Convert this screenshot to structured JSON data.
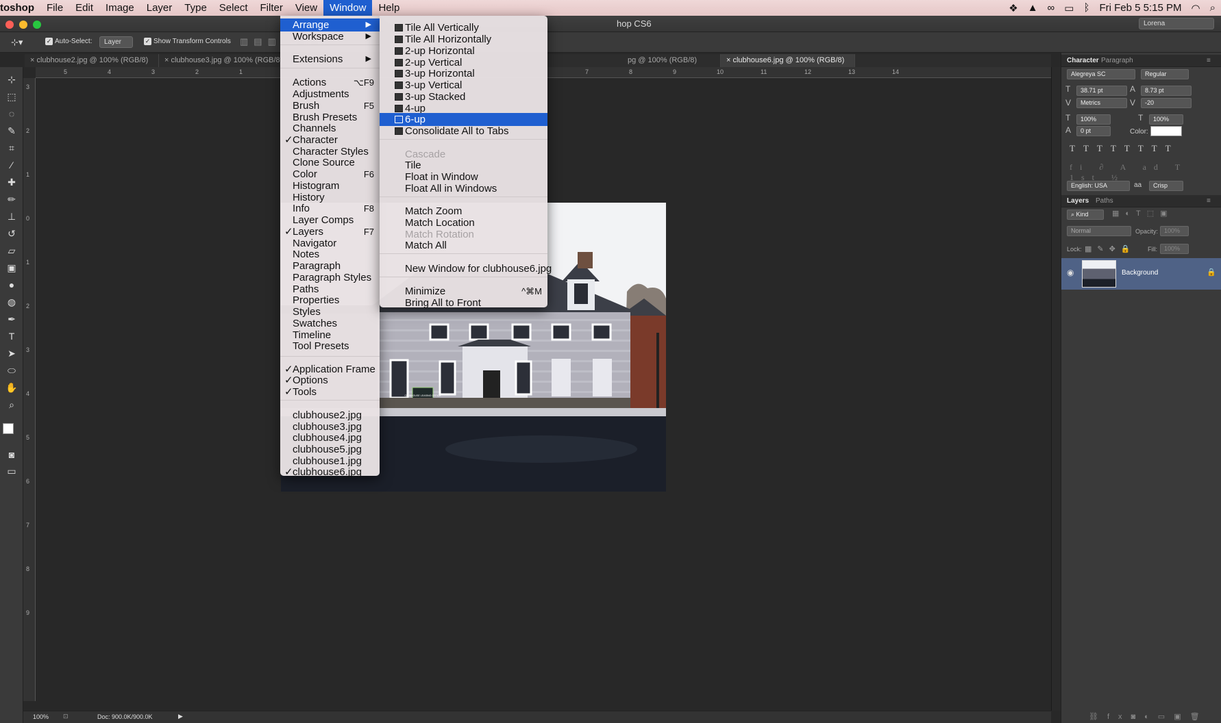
{
  "menubar": {
    "app": "toshop",
    "items": [
      "File",
      "Edit",
      "Image",
      "Layer",
      "Type",
      "Select",
      "Filter",
      "View",
      "Window",
      "Help"
    ],
    "clock": "Fri Feb 5  5:15 PM"
  },
  "titlebar": {
    "title": "hop CS6",
    "workspace": "Lorena"
  },
  "options": {
    "auto_select_label": "Auto-Select:",
    "auto_select_value": "Layer",
    "show_transform": "Show Transform Controls"
  },
  "tabs": [
    "clubhouse2.jpg @ 100% (RGB/8)",
    "clubhouse3.jpg @ 100% (RGB/8)",
    "clu",
    "pg @ 100% (RGB/8)",
    "clubhouse6.jpg @ 100% (RGB/8)"
  ],
  "ruler_h": [
    "5",
    "4",
    "3",
    "2",
    "1",
    "7",
    "8",
    "9",
    "10",
    "11",
    "12",
    "13",
    "14"
  ],
  "ruler_v": [
    "3",
    "2",
    "1",
    "0",
    "1",
    "2",
    "3",
    "4",
    "5",
    "6",
    "7",
    "8",
    "9"
  ],
  "window_menu": {
    "items": [
      {
        "label": "Arrange",
        "arrow": true,
        "highlight": true
      },
      {
        "label": "Workspace",
        "arrow": true
      },
      {
        "label": "Extensions",
        "arrow": true
      },
      {
        "label": "Actions",
        "shortcut": "⌥F9"
      },
      {
        "label": "Adjustments"
      },
      {
        "label": "Brush",
        "shortcut": "F5"
      },
      {
        "label": "Brush Presets"
      },
      {
        "label": "Channels"
      },
      {
        "label": "Character",
        "checked": true
      },
      {
        "label": "Character Styles"
      },
      {
        "label": "Clone Source"
      },
      {
        "label": "Color",
        "shortcut": "F6"
      },
      {
        "label": "Histogram"
      },
      {
        "label": "History"
      },
      {
        "label": "Info",
        "shortcut": "F8"
      },
      {
        "label": "Layer Comps"
      },
      {
        "label": "Layers",
        "checked": true,
        "shortcut": "F7"
      },
      {
        "label": "Navigator"
      },
      {
        "label": "Notes"
      },
      {
        "label": "Paragraph"
      },
      {
        "label": "Paragraph Styles"
      },
      {
        "label": "Paths"
      },
      {
        "label": "Properties"
      },
      {
        "label": "Styles"
      },
      {
        "label": "Swatches"
      },
      {
        "label": "Timeline"
      },
      {
        "label": "Tool Presets"
      },
      {
        "label": "Application Frame",
        "checked": true
      },
      {
        "label": "Options",
        "checked": true
      },
      {
        "label": "Tools",
        "checked": true
      },
      {
        "label": "clubhouse2.jpg"
      },
      {
        "label": "clubhouse3.jpg"
      },
      {
        "label": "clubhouse4.jpg"
      },
      {
        "label": "clubhouse5.jpg"
      },
      {
        "label": "clubhouse1.jpg"
      },
      {
        "label": "clubhouse6.jpg",
        "checked": true
      }
    ]
  },
  "arrange_menu": {
    "items": [
      {
        "label": "Tile All Vertically",
        "icon": true
      },
      {
        "label": "Tile All Horizontally",
        "icon": true
      },
      {
        "label": "2-up Horizontal",
        "icon": true
      },
      {
        "label": "2-up Vertical",
        "icon": true
      },
      {
        "label": "3-up Horizontal",
        "icon": true
      },
      {
        "label": "3-up Vertical",
        "icon": true
      },
      {
        "label": "3-up Stacked",
        "icon": true
      },
      {
        "label": "4-up",
        "icon": true
      },
      {
        "label": "6-up",
        "icon": true,
        "highlight": true
      },
      {
        "label": "Consolidate All to Tabs",
        "icon": true
      },
      {
        "label": "Cascade",
        "disabled": true
      },
      {
        "label": "Tile"
      },
      {
        "label": "Float in Window"
      },
      {
        "label": "Float All in Windows"
      },
      {
        "label": "Match Zoom"
      },
      {
        "label": "Match Location"
      },
      {
        "label": "Match Rotation",
        "disabled": true
      },
      {
        "label": "Match All"
      },
      {
        "label": "New Window for clubhouse6.jpg"
      },
      {
        "label": "Minimize",
        "shortcut": "^⌘M"
      },
      {
        "label": "Bring All to Front"
      }
    ]
  },
  "character_panel": {
    "tabs": [
      "Character",
      "Paragraph"
    ],
    "font_family": "Alegreya SC",
    "font_style": "Regular",
    "size": "38.71 pt",
    "leading": "8.73 pt",
    "kerning": "Metrics",
    "tracking": "-20",
    "vscale": "100%",
    "hscale": "100%",
    "baseline": "0 pt",
    "color_label": "Color:",
    "language": "English: USA",
    "antialias": "Crisp"
  },
  "layers_panel": {
    "tabs": [
      "Layers",
      "Paths"
    ],
    "kind": "Kind",
    "blend": "Normal",
    "opacity_label": "Opacity:",
    "opacity": "100%",
    "lock_label": "Lock:",
    "fill_label": "Fill:",
    "fill": "100%",
    "layer_name": "Background"
  },
  "status": {
    "zoom": "100%",
    "doc": "Doc: 900.0K/900.0K"
  },
  "sign_text": "CLUBHOUSE LEASING OFFICE"
}
